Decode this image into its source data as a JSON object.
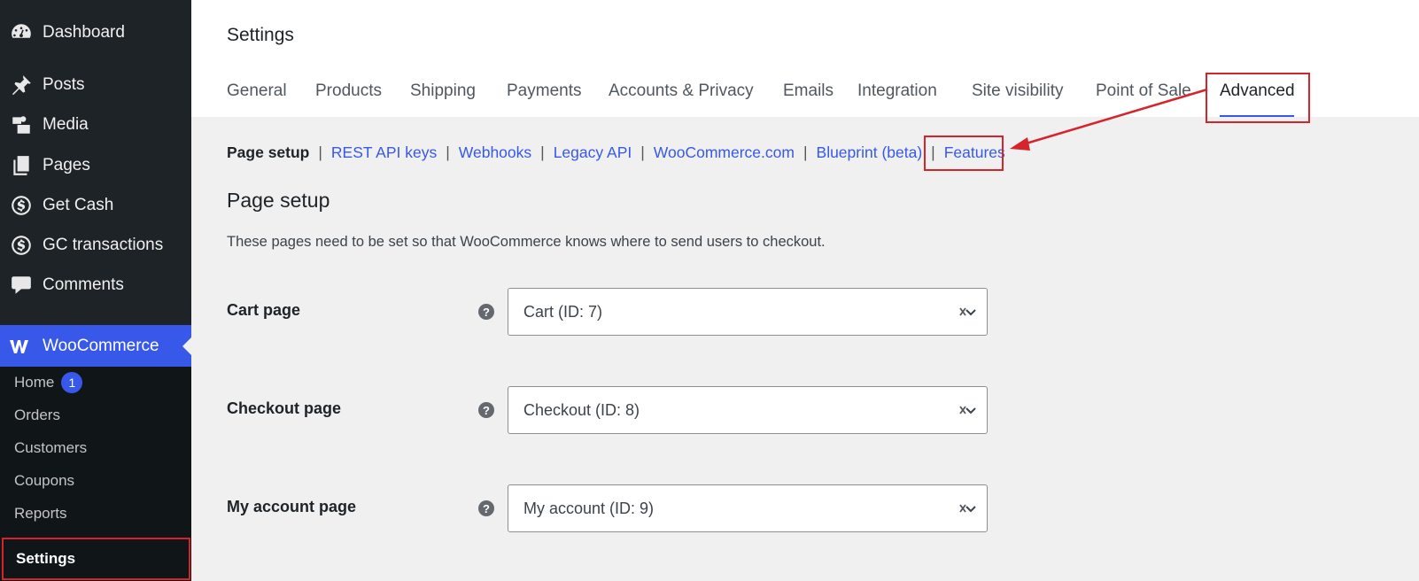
{
  "sidebar": {
    "items": [
      {
        "label": "Dashboard",
        "icon": "dashboard-icon"
      },
      {
        "label": "Posts",
        "icon": "pin-icon"
      },
      {
        "label": "Media",
        "icon": "media-icon"
      },
      {
        "label": "Pages",
        "icon": "pages-icon"
      },
      {
        "label": "Get Cash",
        "icon": "dollar-icon"
      },
      {
        "label": "GC transactions",
        "icon": "dollar-icon"
      },
      {
        "label": "Comments",
        "icon": "comment-icon"
      }
    ],
    "woocommerce": {
      "label": "WooCommerce",
      "icon": "woocommerce-icon"
    },
    "submenu": [
      {
        "label": "Home",
        "badge": "1"
      },
      {
        "label": "Orders"
      },
      {
        "label": "Customers"
      },
      {
        "label": "Coupons"
      },
      {
        "label": "Reports"
      },
      {
        "label": "Settings"
      }
    ]
  },
  "header": {
    "title": "Settings",
    "tabs": [
      "General",
      "Products",
      "Shipping",
      "Payments",
      "Accounts & Privacy",
      "Emails",
      "Integration",
      "Site visibility",
      "Point of Sale",
      "Advanced"
    ],
    "active_tab": "Advanced"
  },
  "subnav": {
    "current": "Page setup",
    "links": [
      "REST API keys",
      "Webhooks",
      "Legacy API",
      "WooCommerce.com",
      "Blueprint (beta)",
      "Features"
    ],
    "separator": "|"
  },
  "section": {
    "title": "Page setup",
    "description": "These pages need to be set so that WooCommerce knows where to send users to checkout."
  },
  "fields": [
    {
      "label": "Cart page",
      "value": "Cart (ID: 7)",
      "help": "?"
    },
    {
      "label": "Checkout page",
      "value": "Checkout (ID: 8)",
      "help": "?"
    },
    {
      "label": "My account page",
      "value": "My account (ID: 9)",
      "help": "?"
    }
  ],
  "colors": {
    "accent": "#3858e9",
    "annotation": "#d6242c",
    "sidebar": "#1d2327"
  }
}
